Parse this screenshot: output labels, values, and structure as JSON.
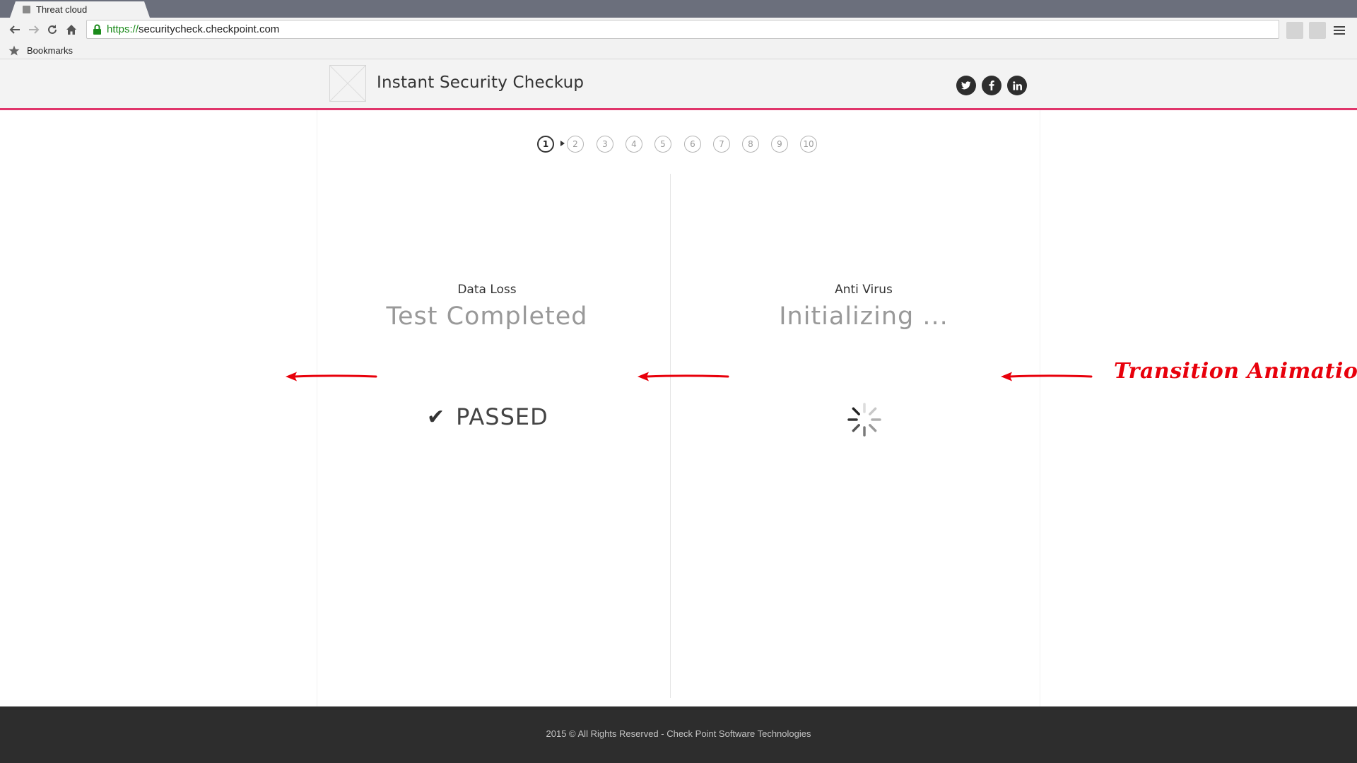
{
  "browser": {
    "tab_title": "Threat cloud",
    "url_scheme": "https://",
    "url_host": "securitycheck.checkpoint.com",
    "bookmarks_label": "Bookmarks"
  },
  "header": {
    "title": "Instant Security Checkup",
    "social": [
      "twitter-icon",
      "facebook-icon",
      "linkedin-icon"
    ],
    "accent_color": "#e0356b"
  },
  "steps": {
    "items": [
      "1",
      "2",
      "3",
      "4",
      "5",
      "6",
      "7",
      "8",
      "9",
      "10"
    ],
    "current": "1"
  },
  "panels": {
    "left": {
      "label": "Data Loss",
      "status": "Test Completed",
      "result": "PASSED",
      "result_icon": "checkmark-icon"
    },
    "right": {
      "label": "Anti Virus",
      "status": "Initializing ...",
      "indicator": "spinner-icon"
    }
  },
  "annotation": {
    "text": "Transition Animation",
    "color": "#e8000b"
  },
  "footer": {
    "text": "2015 © All Rights Reserved - Check Point Software Technologies"
  }
}
